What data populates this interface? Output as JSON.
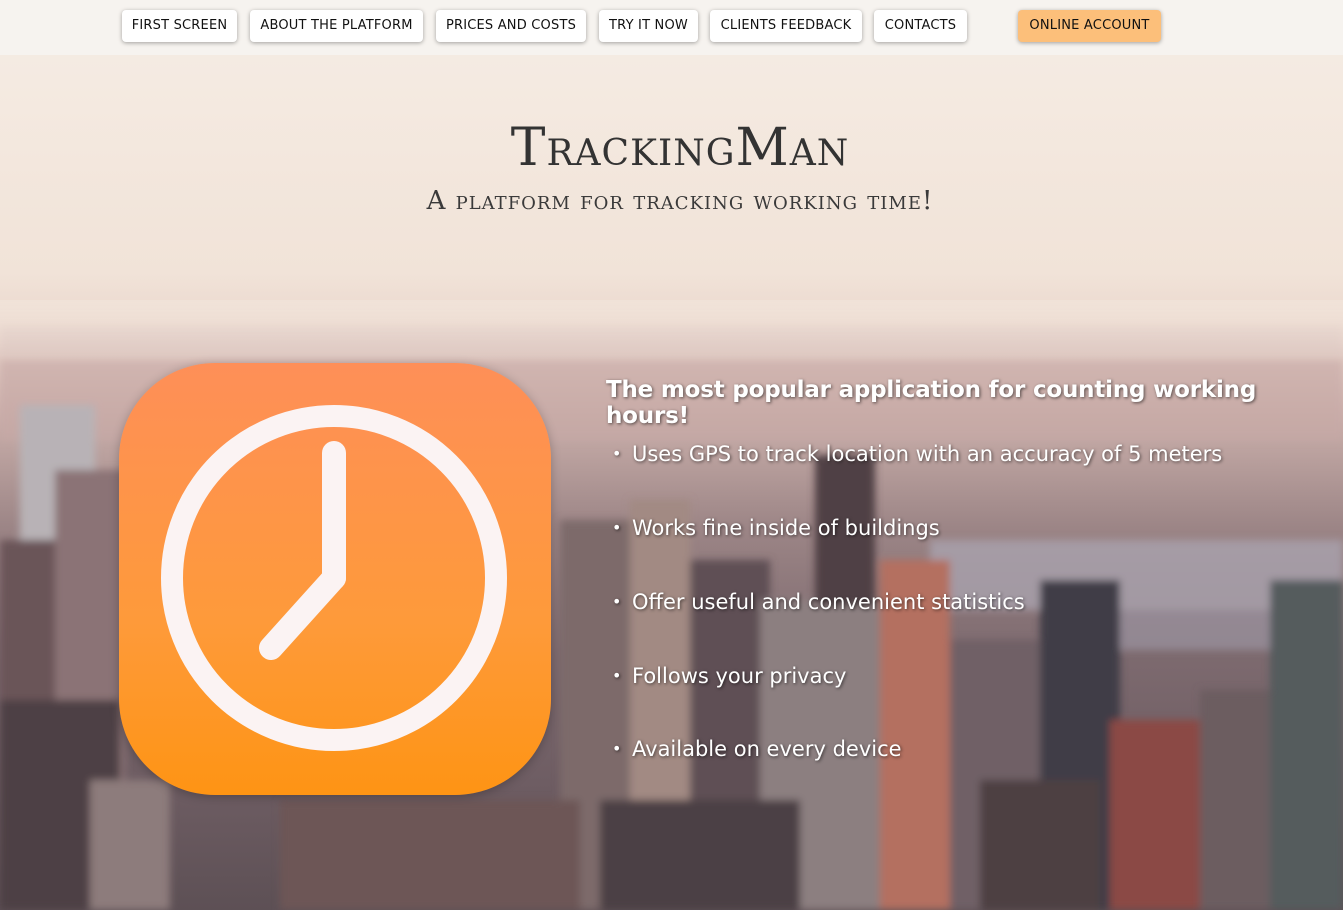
{
  "nav": {
    "items": [
      {
        "label": "FIRST SCREEN"
      },
      {
        "label": "ABOUT THE PLATFORM"
      },
      {
        "label": "PRICES AND COSTS"
      },
      {
        "label": "TRY IT NOW"
      },
      {
        "label": "CLIENTS FEEDBACK"
      },
      {
        "label": "CONTACTS"
      }
    ],
    "account_label": "ONLINE ACCOUNT"
  },
  "hero": {
    "title": "TrackingMan",
    "subtitle": "A platform for tracking working time!"
  },
  "app_icon": {
    "icon": "clock-icon",
    "colors": [
      "#fe8f58",
      "#fe9414"
    ]
  },
  "features": {
    "headline": "The most popular application for counting working hours!",
    "items": [
      "Uses GPS to track location with an accuracy of 5 meters",
      "Works fine inside of buildings",
      "Offer useful and convenient statistics",
      "Follows your privacy",
      "Available on every device"
    ]
  },
  "colors": {
    "account_button": "#fcbf7a",
    "icon_gradient_top": "#fe8f58",
    "icon_gradient_bottom": "#fe9414"
  }
}
